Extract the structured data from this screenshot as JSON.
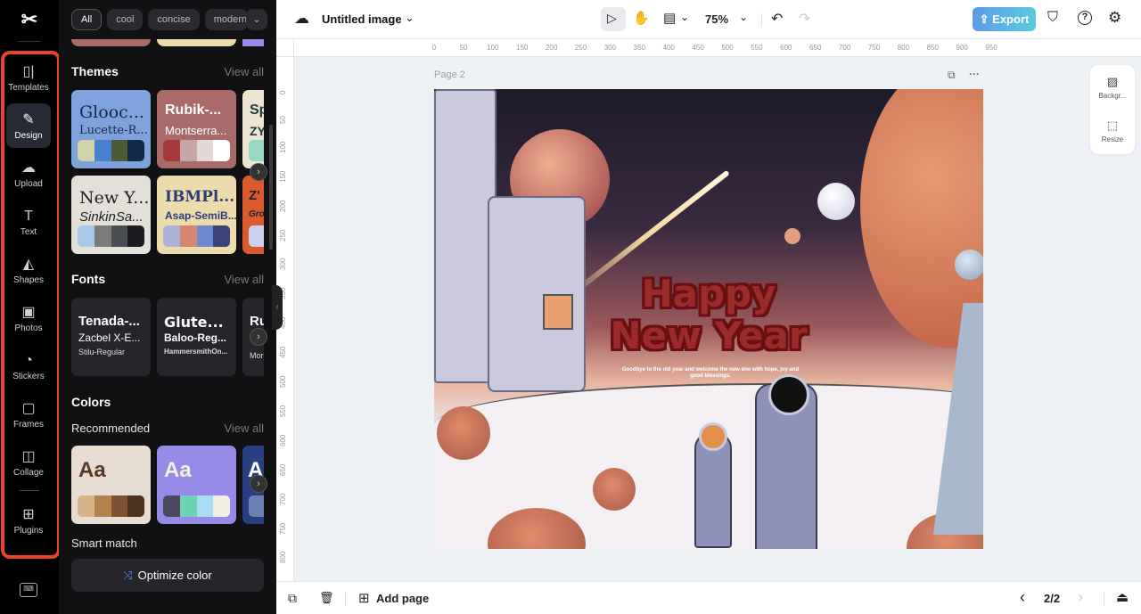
{
  "rail": {
    "logo": "CapCut",
    "items": [
      {
        "label": "Templates",
        "icon": "templates-icon",
        "glyph": "▯|"
      },
      {
        "label": "Design",
        "icon": "design-icon",
        "glyph": "✎"
      },
      {
        "label": "Upload",
        "icon": "upload-cloud-icon",
        "glyph": "☁"
      },
      {
        "label": "Text",
        "icon": "text-icon",
        "glyph": "T"
      },
      {
        "label": "Shapes",
        "icon": "shapes-icon",
        "glyph": "◭"
      },
      {
        "label": "Photos",
        "icon": "photos-icon",
        "glyph": "▣"
      },
      {
        "label": "Stickers",
        "icon": "stickers-icon",
        "glyph": "◔"
      },
      {
        "label": "Frames",
        "icon": "frames-icon",
        "glyph": "▢"
      },
      {
        "label": "Collage",
        "icon": "collage-icon",
        "glyph": "◫"
      },
      {
        "label": "Plugins",
        "icon": "plugins-icon",
        "glyph": "⊞"
      }
    ],
    "active": "Design",
    "keyboard_glyph": "⌨"
  },
  "panel": {
    "chips": [
      "All",
      "cool",
      "concise",
      "modern"
    ],
    "chip_more": "⌄",
    "themes": {
      "title": "Themes",
      "view_all": "View all",
      "cards": [
        {
          "font1": "Glooc...",
          "font2": "Lucette-R...",
          "bg": "#7ea3dc",
          "fg": "#14284a",
          "swatches": [
            "#cfd5a8",
            "#4a80d0",
            "#4b5a30",
            "#0f2a47"
          ]
        },
        {
          "font1": "Rubik-...",
          "font2": "Montserra...",
          "bg": "#a96a6a",
          "fg": "#ffffff",
          "swatches": [
            "#a43a3a",
            "#c9a5a5",
            "#e3d8d8",
            "#ffffff"
          ]
        },
        {
          "font1": "Sp",
          "font2": "ZY",
          "bg": "#ece5d2",
          "fg": "#1f3a3a",
          "swatches": [
            "#96d8c0"
          ]
        },
        {
          "font1": "New Y...",
          "font2": "SinkinSa...",
          "bg": "#e3e0da",
          "fg": "#222222",
          "swatches": [
            "#a9c8ea",
            "#7b7b7b",
            "#4a4d52",
            "#1c1d21"
          ]
        },
        {
          "font1": "IBMPl...",
          "font2": "Asap-SemiB...",
          "bg": "#ecdcab",
          "fg": "#2e3a78",
          "swatches": [
            "#aeb2d8",
            "#d78471",
            "#6d8ad0",
            "#3c4178"
          ]
        },
        {
          "font1": "Z'",
          "font2": "Gro",
          "bg": "#d95a2a",
          "fg": "#222222",
          "swatches": [
            "#cfd0f0"
          ]
        }
      ]
    },
    "fonts": {
      "title": "Fonts",
      "view_all": "View all",
      "cards": [
        {
          "f1": "Tenada-...",
          "f2": "Zacbel X-E...",
          "f3": "Stilu-Regular"
        },
        {
          "f1": "Glute...",
          "f2": "Baloo-Reg...",
          "f3": "HammersmithOn..."
        },
        {
          "f1": "Ru",
          "f2": "",
          "f3": "Mor"
        }
      ]
    },
    "colors": {
      "title": "Colors",
      "recommended": "Recommended",
      "view_all": "View all",
      "cards": [
        {
          "label": "Aa",
          "bg": "#e8ddd2",
          "fg": "#5a3a25",
          "swatches": [
            "#d6b48a",
            "#b2834e",
            "#7c5230",
            "#4f3320"
          ]
        },
        {
          "label": "Aa",
          "bg": "#958be6",
          "fg": "#f5f0e0",
          "swatches": [
            "#4a4761",
            "#6dd2b4",
            "#a9dcf5",
            "#f2efe0"
          ]
        },
        {
          "label": "A",
          "bg": "#2a3f82",
          "fg": "#ffffff",
          "swatches": [
            "#6a82b8"
          ]
        }
      ],
      "smart_match": "Smart match",
      "optimize": "Optimize color",
      "optimize_icon": "⤨"
    },
    "next_arrow": "›"
  },
  "topbar": {
    "cloud_icon": "☁",
    "title": "Untitled image",
    "title_caret": "⌄",
    "select_icon": "▷",
    "hand_icon": "✋",
    "layout_icon": "▤",
    "layout_caret": "⌄",
    "zoom": "75%",
    "zoom_caret": "⌄",
    "undo_icon": "↶",
    "redo_icon": "↷",
    "export": "⇪ Export",
    "shield_icon": "⛉",
    "help_icon": "?",
    "settings_icon": "⚙"
  },
  "rulers": {
    "h": [
      "0",
      "50",
      "100",
      "150",
      "200",
      "250",
      "300",
      "350",
      "400",
      "450",
      "500",
      "550",
      "600",
      "650",
      "700",
      "750",
      "800",
      "850",
      "900",
      "950"
    ],
    "v": [
      "0",
      "50",
      "100",
      "150",
      "200",
      "250",
      "300",
      "350",
      "400",
      "450",
      "500",
      "550",
      "600",
      "650",
      "700",
      "750",
      "800"
    ]
  },
  "canvas": {
    "page_label": "Page 2",
    "duplicate_icon": "⧉",
    "more_icon": "···",
    "headline_line1": "Happy",
    "headline_line2": "New Year",
    "subtext": "Goodbye to the old year and welcome the new one with hope, joy and good blessings."
  },
  "sidetools": [
    {
      "label": "Backgr...",
      "glyph": "▨"
    },
    {
      "label": "Resize",
      "glyph": "⬚"
    }
  ],
  "bottombar": {
    "duplicate_page_icon": "⧉",
    "delete_icon": "🗑",
    "add_page": "Add page",
    "add_page_icon": "⊞",
    "prev": "‹",
    "page_indicator": "2/2",
    "next": "›",
    "layers_icon": "⏏"
  }
}
